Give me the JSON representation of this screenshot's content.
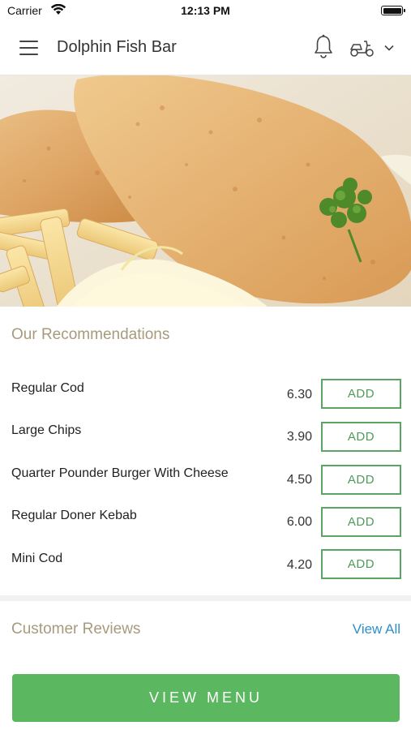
{
  "status_bar": {
    "carrier": "Carrier",
    "time": "12:13 PM"
  },
  "header": {
    "title": "Dolphin Fish Bar",
    "icons": [
      "menu-icon",
      "bell-icon",
      "delivery-scooter-icon",
      "chevron-down-icon"
    ]
  },
  "recommendations": {
    "title": "Our Recommendations",
    "items": [
      {
        "name": "Regular Cod",
        "price": "6.30",
        "button": "ADD"
      },
      {
        "name": "Large Chips",
        "price": "3.90",
        "button": "ADD"
      },
      {
        "name": "Quarter Pounder Burger With Cheese",
        "price": "4.50",
        "button": "ADD"
      },
      {
        "name": "Regular Doner Kebab",
        "price": "6.00",
        "button": "ADD"
      },
      {
        "name": "Mini Cod",
        "price": "4.20",
        "button": "ADD"
      }
    ]
  },
  "reviews": {
    "title": "Customer Reviews",
    "view_all": "View All"
  },
  "footer": {
    "view_menu": "VIEW MENU"
  },
  "colors": {
    "accent_green": "#5cb860",
    "section_title": "#a89a7c",
    "link_blue": "#2e8fcb"
  }
}
